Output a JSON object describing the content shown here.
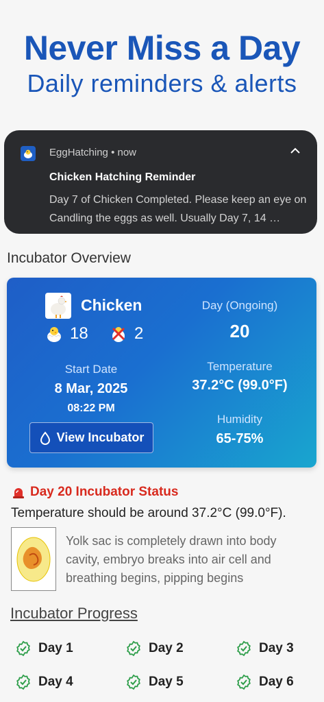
{
  "hero": {
    "title": "Never Miss a Day",
    "subtitle": "Daily reminders & alerts"
  },
  "notification": {
    "app_name": "EggHatching",
    "time": "now",
    "title": "Chicken Hatching Reminder",
    "body": "Day 7 of Chicken Completed. Please keep an eye on Candling the eggs as well. Usually Day 7, 14 …"
  },
  "overview": {
    "section_title": "Incubator Overview",
    "animal": "Chicken",
    "hatched_count": "18",
    "failed_count": "2",
    "day_label": "Day (Ongoing)",
    "day_value": "20",
    "start_label": "Start Date",
    "start_date": "8 Mar, 2025",
    "start_time": "08:22 PM",
    "temp_label": "Temperature",
    "temp_value": "37.2°C (99.0°F)",
    "humidity_label": "Humidity",
    "humidity_value": "65-75%",
    "view_button": "View Incubator"
  },
  "status": {
    "title": "Day 20 Incubator Status",
    "temp_text": "Temperature should be around 37.2°C (99.0°F).",
    "description": "Yolk sac is completely drawn into body cavity, embryo breaks into air cell and breathing begins, pipping begins"
  },
  "progress": {
    "title": "Incubator Progress",
    "days": [
      "Day 1",
      "Day 2",
      "Day 3",
      "Day 4",
      "Day 5",
      "Day 6"
    ]
  },
  "colors": {
    "brand": "#1a56b8",
    "alert": "#d82a1e",
    "check": "#2e9e4a"
  }
}
